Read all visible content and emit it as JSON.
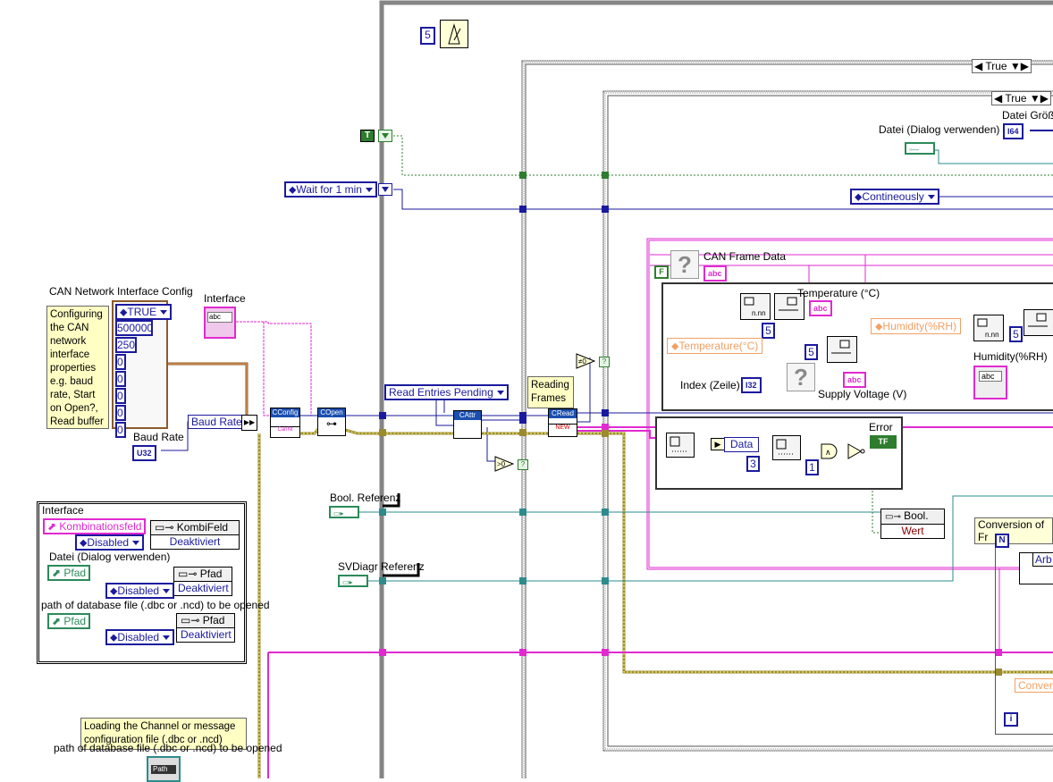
{
  "wait_node": {
    "value": "5"
  },
  "case_outer": {
    "selector": "True"
  },
  "case_inner": {
    "selector": "True"
  },
  "const_true": {
    "label": "T"
  },
  "const_false": {
    "label": "F"
  },
  "wait_enum": {
    "value": "Wait for 1 min"
  },
  "file_size": {
    "label": "Datei Größ"
  },
  "file_dialog": {
    "label": "Datei (Dialog verwenden)"
  },
  "file_type": {
    "value": "I64"
  },
  "contineously": {
    "value": "Contineously"
  },
  "can_frame": {
    "label": "CAN Frame Data",
    "type": "abc"
  },
  "temperature": {
    "label": "Temperature (°C)",
    "ctrl": "Temperature(°C)",
    "index": "5",
    "type": "abc"
  },
  "humidity": {
    "label": "Humidity(%RH)",
    "ctrl": "Humidity(%RH)",
    "index": "5",
    "type": "abc"
  },
  "supply_voltage": {
    "label": "Supply Voltage (V)",
    "index": "5",
    "type": "abc"
  },
  "index_row": {
    "label": "Index (Zeile)",
    "type": "I32"
  },
  "can_config": {
    "label": "CAN Network Interface Config",
    "enum": "TRUE",
    "values": [
      "500000",
      "250",
      "0",
      "0",
      "0",
      "0",
      "0"
    ]
  },
  "config_note": {
    "text": "Configuring the CAN network interface properties e.g. baud rate, Start on Open?, Read buffer"
  },
  "interface": {
    "label": "Interface",
    "type": "abc"
  },
  "baud_rate": {
    "label": "Baud Rate",
    "ind": "Baud Rate",
    "type": "U32"
  },
  "read_entries": {
    "value": "Read Entries Pending"
  },
  "reading_frames": {
    "text": "Reading Frames"
  },
  "data_node": {
    "label": "Data",
    "index": "3",
    "num": "1"
  },
  "error": {
    "label": "Error",
    "type": "TF"
  },
  "bool_ref": {
    "label": "Bool. Referenz",
    "prop": "Bool.",
    "field": "Wert"
  },
  "svdiagr_ref": {
    "label": "SVDiagr Referenz"
  },
  "conversion": {
    "label": "Conversion of Fr",
    "n": "N",
    "i": "i",
    "arb": "Arb",
    "convert": "Convert"
  },
  "interface_panel": {
    "title": "Interface",
    "kombi_ctrl": "Kombinationsfeld",
    "kombi_prop": "KombiFeld",
    "disabled": "Disabled",
    "deaktiviert": "Deaktiviert",
    "datei_label": "Datei (Dialog verwenden)",
    "pfad": "Pfad",
    "path_label": "path of database file (.dbc or .ncd) to be opened"
  },
  "loading_note": {
    "text": "Loading the Channel or message configuration file (.dbc or .ncd)"
  },
  "path_bottom": {
    "label": "path of database file (.dbc or .ncd) to be opened",
    "ctrl": "Path"
  },
  "subvis": {
    "config": "CConfig",
    "config_sub": "CanNt",
    "open": "COpen",
    "attr": "CAttr",
    "read": "CRead",
    "read_sub": "NEW"
  },
  "colors": {
    "wire_blue": "#1a1a9e",
    "wire_pink": "#e02ad0",
    "wire_teal": "#2e8b8b",
    "wire_green": "#2e7d2e",
    "wire_error": "#9b8b2e",
    "frame_gray": "#858585"
  }
}
